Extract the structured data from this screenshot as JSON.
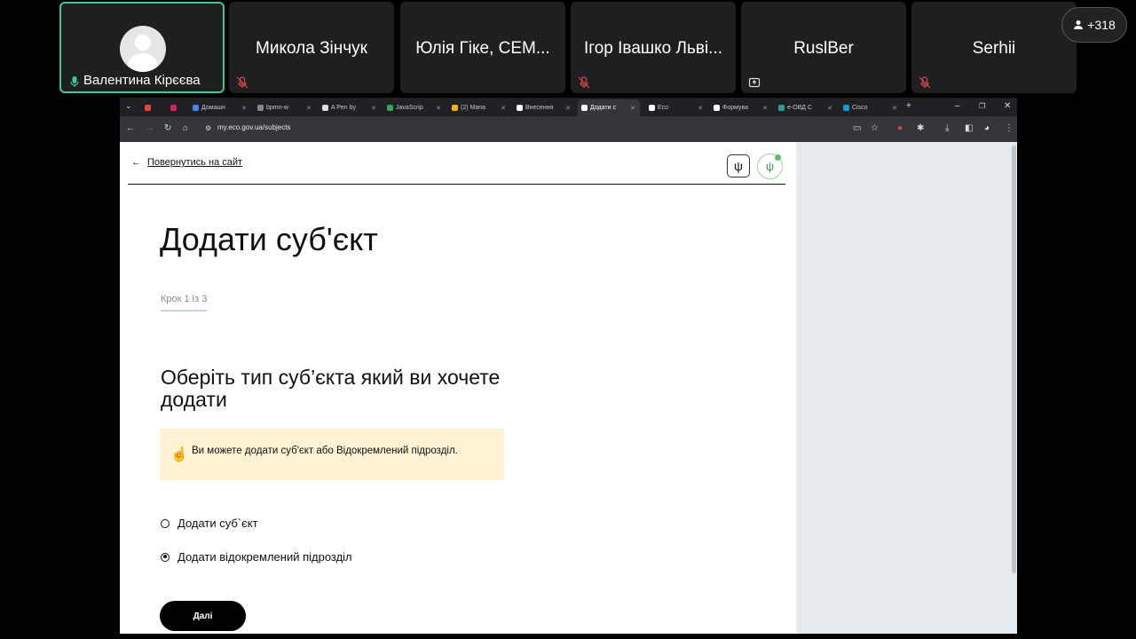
{
  "participants": {
    "active": {
      "name": "Валентина Кірєєва",
      "avatar": "default-avatar"
    },
    "others": [
      {
        "name": "Микола Зінчук",
        "status_icon": "mic-muted-icon"
      },
      {
        "name": "Юлія Гіке, CEM...",
        "status_icon": "mic-muted-icon"
      },
      {
        "name": "Ігор Івашко Львi...",
        "status_icon": "mic-muted-icon"
      },
      {
        "name": "RuslBer",
        "status_icon": "share-screen-icon"
      },
      {
        "name": "Serhii",
        "status_icon": "mic-muted-icon"
      }
    ],
    "count": "+318"
  },
  "browser": {
    "tabs": [
      {
        "label": "",
        "color": "#ea4335"
      },
      {
        "label": "",
        "color": "#e01e5a"
      },
      {
        "label": "Домашн",
        "color": "#4285f4"
      },
      {
        "label": "bpmn-w",
        "color": "#888888"
      },
      {
        "label": "A Pen by",
        "color": "#dddddd"
      },
      {
        "label": "JavaScrip",
        "color": "#34a853"
      },
      {
        "label": "(2) Мапа",
        "color": "#f4b400"
      },
      {
        "label": "Внесення",
        "color": "#222222"
      },
      {
        "label": "Додати с",
        "color": "#222222"
      },
      {
        "label": "Eco",
        "color": "#222222"
      },
      {
        "label": "Формува",
        "color": "#222222"
      },
      {
        "label": "е-ОВД С",
        "color": "#2aa198"
      },
      {
        "label": "Cisco",
        "color": "#049fd9"
      }
    ],
    "active_tab_index": 8,
    "url": "my.eco.gov.ua/subjects"
  },
  "page": {
    "back_link": "Повернутись на сайт",
    "title": "Додати суб'єкт",
    "step": "Крок 1 із 3",
    "question": "Оберіть тип суб’єкта який ви хочете додати",
    "notice": "Ви можете додати суб'єкт або Відокремлений підрозділ.",
    "options": [
      {
        "label": "Додати суб`єкт",
        "selected": false
      },
      {
        "label": "Додати відокремлений підрозділ",
        "selected": true
      }
    ],
    "next_button": "Далі",
    "accent_notice": "#fdf3d4",
    "sidebar_color": "#e6ebef"
  }
}
